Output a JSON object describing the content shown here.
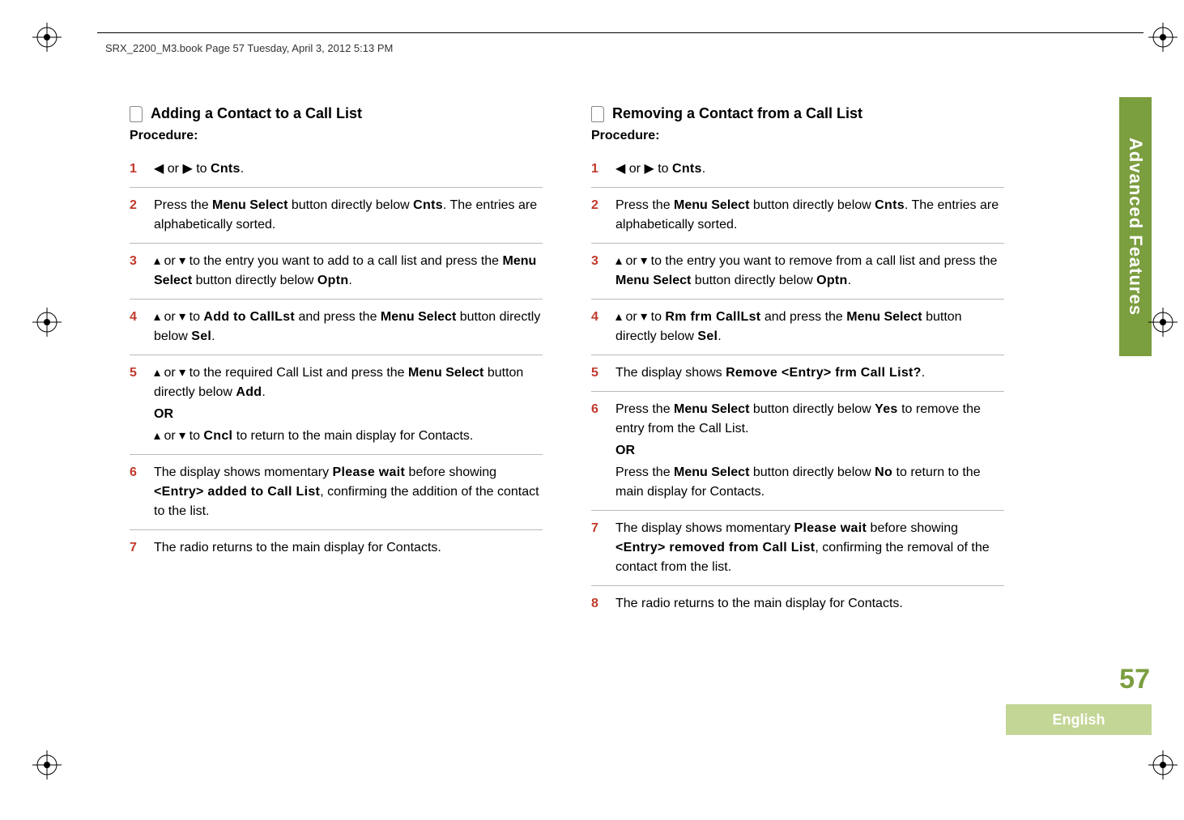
{
  "header": "SRX_2200_M3.book  Page 57  Tuesday, April 3, 2012  5:13 PM",
  "side_tab": "Advanced Features",
  "page_number": "57",
  "language": "English",
  "left": {
    "title": "Adding a Contact to a Call List",
    "procedure": "Procedure:",
    "steps": {
      "s1a": "◀",
      "s1b": " or ",
      "s1c": "▶",
      "s1d": " to ",
      "s1e": "Cnts",
      "s1f": ".",
      "s2a": "Press the ",
      "s2b": "Menu Select",
      "s2c": " button directly below ",
      "s2d": "Cnts",
      "s2e": ". The entries are alphabetically sorted.",
      "s3a": "▴",
      "s3b": " or ",
      "s3c": "▾",
      "s3d": " to the entry you want to add to a call list and press the ",
      "s3e": "Menu Select",
      "s3f": " button directly below ",
      "s3g": "Optn",
      "s3h": ".",
      "s4a": "▴",
      "s4b": " or ",
      "s4c": "▾",
      "s4d": " to ",
      "s4e": "Add to CallLst",
      "s4f": " and press the ",
      "s4g": "Menu Select",
      "s4h": " button directly below ",
      "s4i": "Sel",
      "s4j": ".",
      "s5a": "▴",
      "s5b": " or ",
      "s5c": "▾",
      "s5d": " to the required Call List and press the ",
      "s5e": "Menu Select",
      "s5f": " button directly below ",
      "s5g": "Add",
      "s5h": ".",
      "s5or": "OR",
      "s5i": "▴",
      "s5j": " or ",
      "s5k": "▾",
      "s5l": " to ",
      "s5m": "Cncl",
      "s5n": " to return to the main display for Contacts.",
      "s6a": "The display shows momentary ",
      "s6b": "Please wait",
      "s6c": " before showing ",
      "s6d": "<Entry> added to Call List",
      "s6e": ", confirming the addition of the contact to the list.",
      "s7a": "The radio returns to the main display for Contacts."
    }
  },
  "right": {
    "title": "Removing a Contact from a Call List",
    "procedure": "Procedure:",
    "steps": {
      "s1a": "◀",
      "s1b": " or ",
      "s1c": "▶",
      "s1d": " to ",
      "s1e": "Cnts",
      "s1f": ".",
      "s2a": "Press the ",
      "s2b": "Menu Select",
      "s2c": " button directly below ",
      "s2d": "Cnts",
      "s2e": ". The entries are alphabetically sorted.",
      "s3a": "▴",
      "s3b": " or ",
      "s3c": "▾",
      "s3d": " to the entry you want to remove from a call list and press the ",
      "s3e": "Menu Select",
      "s3f": " button directly below ",
      "s3g": "Optn",
      "s3h": ".",
      "s4a": "▴",
      "s4b": " or ",
      "s4c": "▾",
      "s4d": " to ",
      "s4e": "Rm frm CallLst",
      "s4f": " and press the ",
      "s4g": "Menu Select",
      "s4h": " button directly below ",
      "s4i": "Sel",
      "s4j": ".",
      "s5a": "The display shows ",
      "s5b": "Remove <Entry> frm Call List?",
      "s5c": ".",
      "s6a": "Press the ",
      "s6b": "Menu Select",
      "s6c": " button directly below ",
      "s6d": "Yes",
      "s6e": " to remove the entry from the Call List.",
      "s6or": "OR",
      "s6f": "Press the ",
      "s6g": "Menu Select",
      "s6h": " button directly below ",
      "s6i": "No",
      "s6j": " to return to the main display for Contacts.",
      "s7a": "The display shows momentary ",
      "s7b": "Please wait",
      "s7c": " before showing ",
      "s7d": "<Entry> removed from Call List",
      "s7e": ", confirming the removal of the contact from the list.",
      "s8a": "The radio returns to the main display for Contacts."
    }
  },
  "nums": {
    "n1": "1",
    "n2": "2",
    "n3": "3",
    "n4": "4",
    "n5": "5",
    "n6": "6",
    "n7": "7",
    "n8": "8"
  }
}
